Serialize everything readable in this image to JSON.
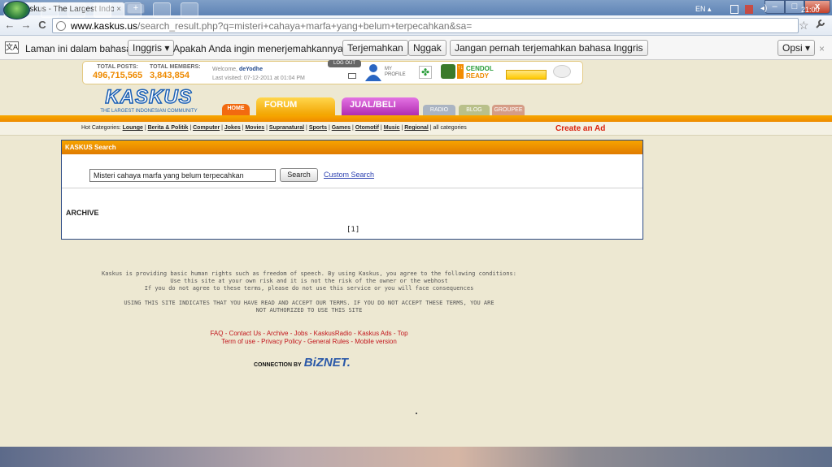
{
  "browser": {
    "tab_title": "Kaskus - The Largest Indone",
    "tab_close": "×",
    "new_tab": "+",
    "window_buttons": {
      "minimize": "–",
      "maximize": "□",
      "close": "x"
    },
    "nav": {
      "back": "←",
      "forward": "→",
      "reload": "C"
    },
    "url_host": "www.kaskus.us",
    "url_path": "/search_result.php?q=misteri+cahaya+marfa+yang+belum+terpecahkan&sa=",
    "star": "☆",
    "wrench": "🔧"
  },
  "translate_bar": {
    "icon": "文A",
    "prefix": "Laman ini dalam bahasa",
    "language": "Inggris ▾",
    "question": "Apakah Anda ingin menerjemahkannya?",
    "translate": "Terjemahkan",
    "nope": "Nggak",
    "never": "Jangan pernah terjemahkan bahasa Inggris",
    "options": "Opsi ▾",
    "close": "×"
  },
  "kaskus": {
    "total_posts_label": "TOTAL POSTS:",
    "total_posts": "496,715,565",
    "total_members_label": "TOTAL MEMBERS:",
    "total_members": "3,843,854",
    "welcome_prefix": "Welcome, ",
    "username": "deYodhe",
    "last_visited": "Last visited: 07-12-2011 at 01:04 PM",
    "logout": "LOG OUT",
    "my_profile": "MY PROFILE",
    "cendol": "CENDOL",
    "ready": "READY",
    "logo": "KASKUS",
    "logo_tagline": "THE LARGEST INDONESIAN COMMUNITY",
    "nav": {
      "home": "HOME",
      "forum": "FORUM",
      "jual": "JUAL/BELI",
      "radio": "RADIO",
      "blog": "BLOG",
      "groupee": "GROUPEE"
    },
    "hot_label": "Hot Categories:",
    "hot_categories": [
      "Lounge",
      "Berita & Politik",
      "Computer",
      "Jokes",
      "Movies",
      "Supranatural",
      "Sports",
      "Games",
      "Otomotif",
      "Music",
      "Regional"
    ],
    "all_categories": "all categories",
    "create_ad": "Create an Ad"
  },
  "search": {
    "panel_title": "KASKUS Search",
    "query": "Misteri cahaya marfa yang belum terpecahkan",
    "button": "Search",
    "custom_search": "Custom Search",
    "archive": "ARCHIVE",
    "pager": "[1]"
  },
  "footer": {
    "line1": "Kaskus is providing basic human rights such as freedom of speech. By using Kaskus, you agree to the following conditions:",
    "line2": "Use this site at your own risk and it is not the risk of the owner or the webhost",
    "line3": "If you do not agree to these terms, please do not use this service or you will face consequences",
    "line4": "USING THIS SITE INDICATES THAT YOU HAVE READ AND ACCEPT OUR TERMS. IF YOU DO NOT ACCEPT THESE TERMS, YOU ARE",
    "line5": "NOT AUTHORIZED TO USE THIS SITE",
    "links1": "FAQ - Contact Us - Archive - Jobs - KaskusRadio - Kaskus Ads - Top",
    "links2": "Term of use - Privacy Policy - General Rules - Mobile version",
    "connection_by": "CONNECTION BY",
    "biznet": "BiZNET."
  },
  "taskbar": {
    "tray": "EN  ▴",
    "clock": "21:00"
  }
}
